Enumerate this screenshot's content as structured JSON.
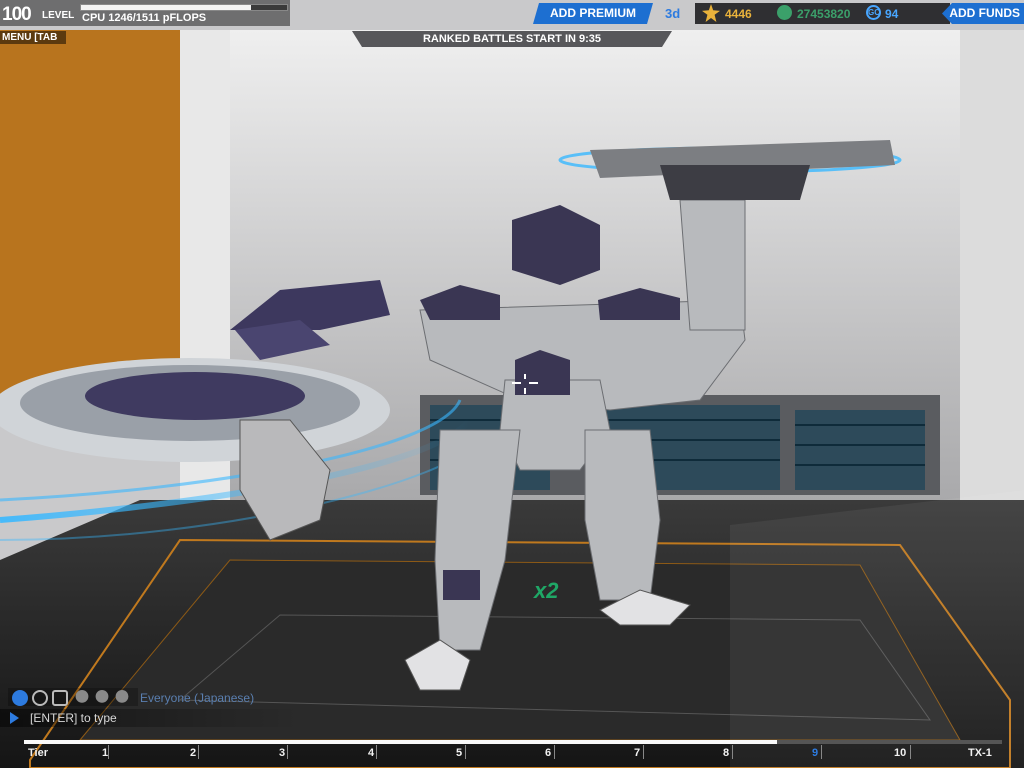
{
  "hud": {
    "level_value": "100",
    "level_label": "LEVEL",
    "cpu_text": "CPU 1246/1511 pFLOPS",
    "cpu_progress": 0.8246,
    "add_premium": "ADD PREMIUM",
    "premium_days": "3d",
    "xp_value": "4446",
    "robits_value": "27453820",
    "cosmetic_value": "94",
    "cosmetic_icon_text": "GC",
    "add_funds": "ADD FUNDS",
    "menu_label": "MENU [TAB",
    "ranked_text": "RANKED BATTLES START IN 9:35",
    "multiplier": "x2"
  },
  "chat": {
    "channel": "Everyone (Japanese)",
    "input_hint": "[ENTER] to type",
    "icons": [
      "globe-icon",
      "person-icon",
      "party-icon",
      "user1-icon",
      "user2-icon",
      "user3-icon"
    ]
  },
  "tier_bar": {
    "progress": 0.77,
    "labels": [
      "Tier",
      "1",
      "2",
      "3",
      "4",
      "5",
      "6",
      "7",
      "8",
      "9",
      "10",
      "TX-1"
    ],
    "active_label": "9"
  },
  "colors": {
    "accent_blue": "#1d6fd1",
    "xp_gold": "#e9b23b",
    "robits_green": "#3ba06a",
    "cc_blue": "#48a6ff",
    "multiplier_green": "#1fa766"
  }
}
